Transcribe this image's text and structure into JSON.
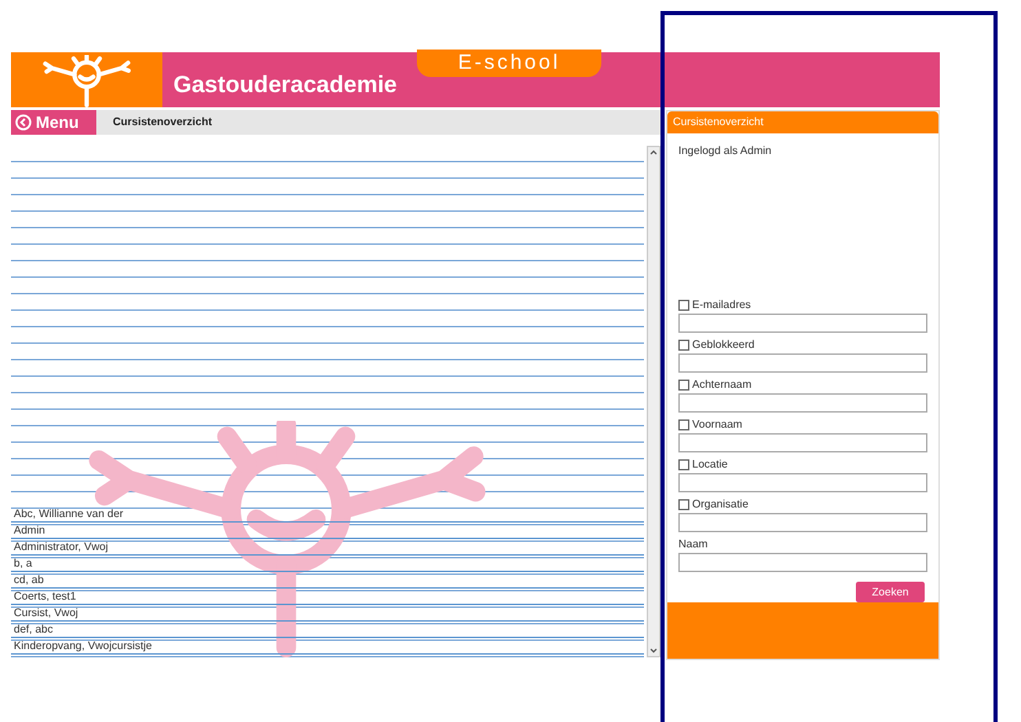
{
  "header": {
    "badge": "E-school",
    "title": "Gastouderacademie"
  },
  "nav": {
    "menu_button": "Menu",
    "breadcrumb": "Cursistenoverzicht"
  },
  "list": {
    "rows": [
      "Abc, Willianne van der",
      "Admin",
      "Administrator, Vwoj",
      "b, a",
      "cd, ab",
      "Coerts, test1",
      "Cursist, Vwoj",
      "def, abc",
      "Kinderopvang, Vwojcursistje"
    ]
  },
  "panel": {
    "title": "Cursistenoverzicht",
    "logged_in": "Ingelogd als Admin",
    "filters": [
      {
        "label": "E-mailadres",
        "kind": "checkbox",
        "checked": false
      },
      {
        "label": "Geblokkeerd",
        "kind": "checkbox",
        "checked": false
      },
      {
        "label": "Achternaam",
        "kind": "checkbox",
        "checked": false
      },
      {
        "label": "Voornaam",
        "kind": "checkbox",
        "checked": false
      },
      {
        "label": "Locatie",
        "kind": "checkbox",
        "checked": false
      },
      {
        "label": "Organisatie",
        "kind": "checkbox",
        "checked": false
      },
      {
        "label": "Naam",
        "kind": "text"
      }
    ],
    "search_button": "Zoeken"
  }
}
